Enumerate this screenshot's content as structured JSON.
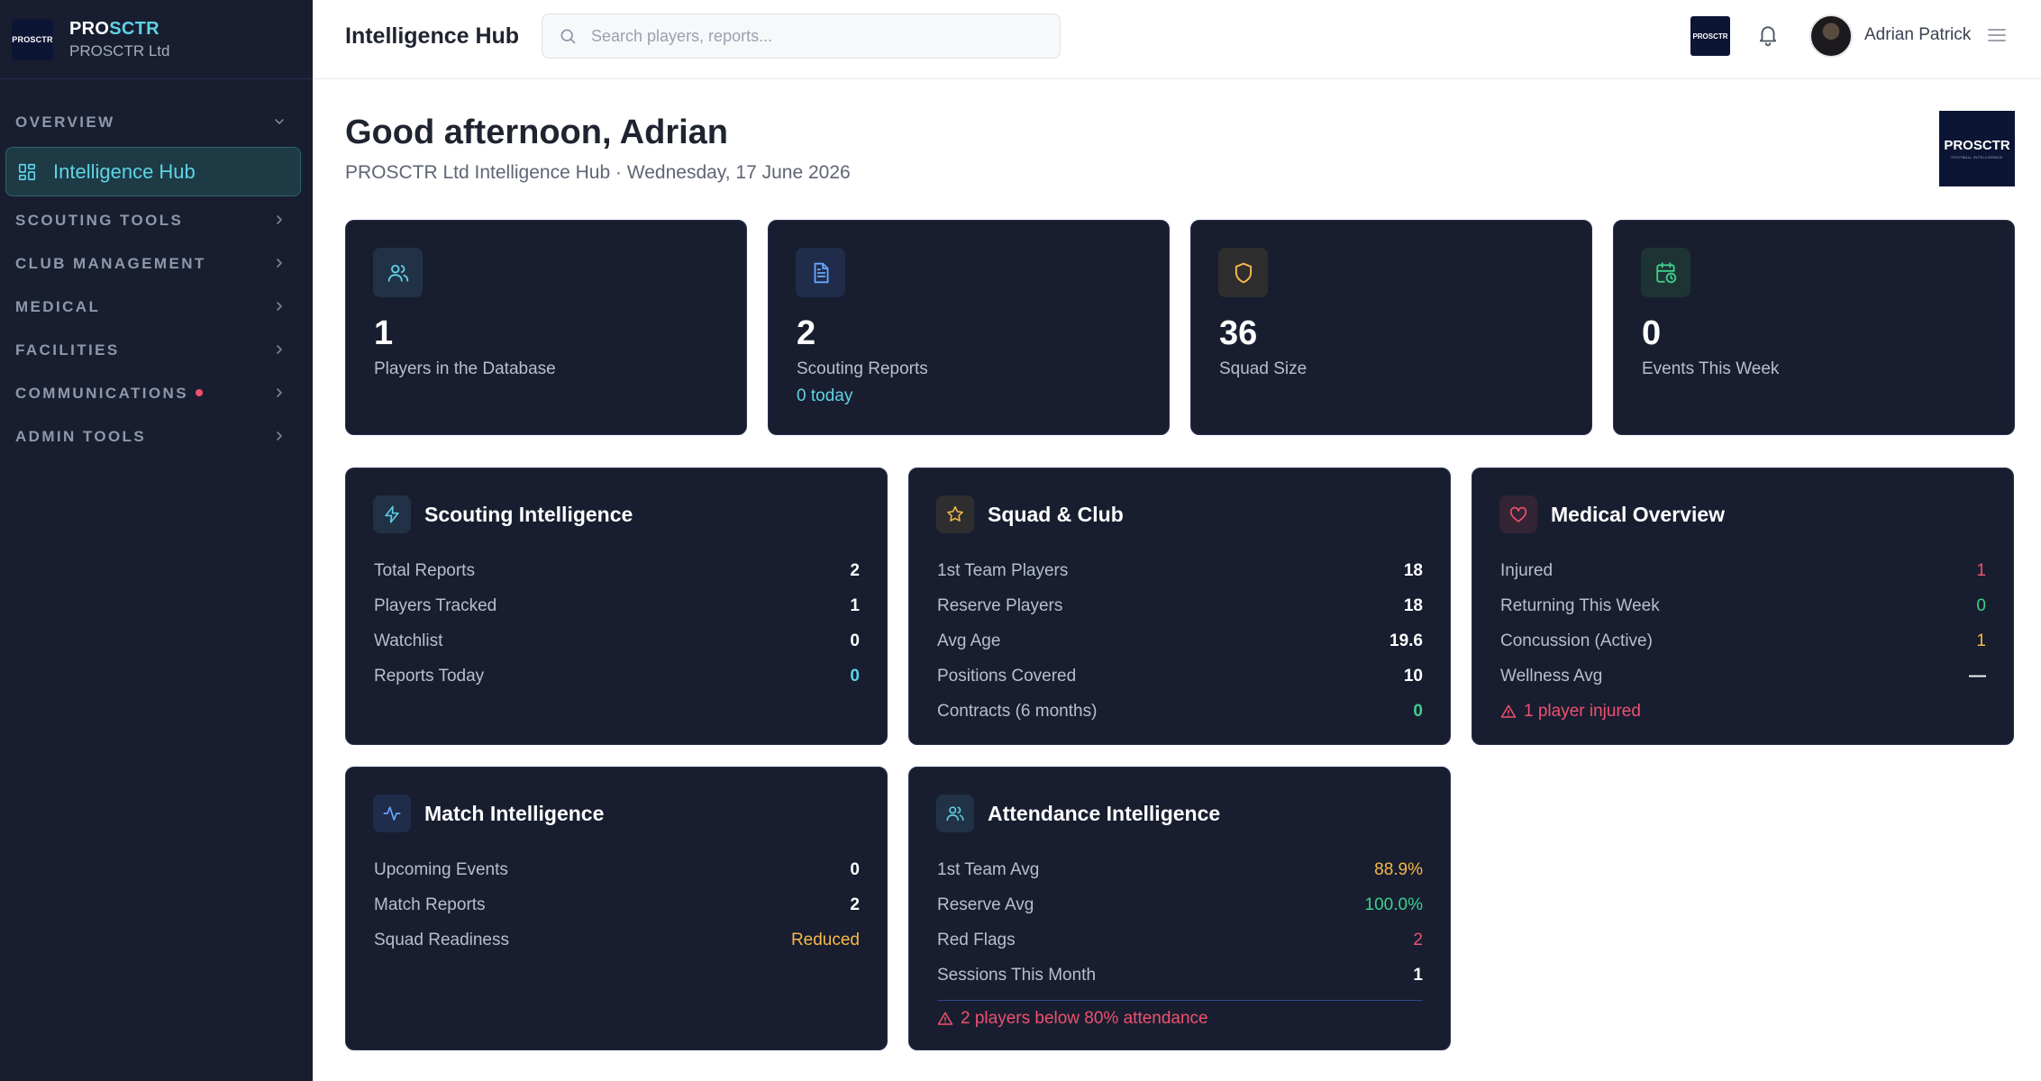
{
  "sidebar": {
    "brand": {
      "logo_text": "PROSCTR",
      "name_pro": "PRO",
      "name_sctr": "SCTR",
      "org": "PROSCTR Ltd"
    },
    "sections": {
      "overview": "OVERVIEW",
      "scouting_tools": "SCOUTING TOOLS",
      "club_management": "CLUB MANAGEMENT",
      "medical": "MEDICAL",
      "facilities": "FACILITIES",
      "communications": "COMMUNICATIONS",
      "admin_tools": "ADMIN TOOLS"
    },
    "active_item": "Intelligence Hub",
    "communications_has_notification": true
  },
  "header": {
    "title": "Intelligence Hub",
    "search_placeholder": "Search players, reports...",
    "logo_text": "PROSCTR",
    "user_name": "Adrian Patrick"
  },
  "main": {
    "greeting": "Good afternoon, Adrian",
    "subtitle": "PROSCTR Ltd Intelligence Hub · Wednesday, 17 June 2026",
    "logo_text": "PROSCTR",
    "logo_tagline": "FOOTBALL INTELLIGENCE"
  },
  "stats": [
    {
      "icon": "users-icon",
      "value": "1",
      "label": "Players in the Database",
      "sub": ""
    },
    {
      "icon": "document-icon",
      "value": "2",
      "label": "Scouting Reports",
      "sub": "0 today"
    },
    {
      "icon": "shield-icon",
      "value": "36",
      "label": "Squad Size",
      "sub": ""
    },
    {
      "icon": "calendar-clock-icon",
      "value": "0",
      "label": "Events This Week",
      "sub": ""
    }
  ],
  "panels": {
    "scouting": {
      "title": "Scouting Intelligence",
      "rows": [
        {
          "label": "Total Reports",
          "value": "2"
        },
        {
          "label": "Players Tracked",
          "value": "1"
        },
        {
          "label": "Watchlist",
          "value": "0"
        },
        {
          "label": "Reports Today",
          "value": "0"
        }
      ]
    },
    "squad": {
      "title": "Squad & Club",
      "rows": [
        {
          "label": "1st Team Players",
          "value": "18"
        },
        {
          "label": "Reserve Players",
          "value": "18"
        },
        {
          "label": "Avg Age",
          "value": "19.6"
        },
        {
          "label": "Positions Covered",
          "value": "10"
        },
        {
          "label": "Contracts (6 months)",
          "value": "0"
        }
      ]
    },
    "medical": {
      "title": "Medical Overview",
      "rows": [
        {
          "label": "Injured",
          "value": "1"
        },
        {
          "label": "Returning This Week",
          "value": "0"
        },
        {
          "label": "Concussion (Active)",
          "value": "1"
        },
        {
          "label": "Wellness Avg",
          "value": "—"
        }
      ],
      "alert": "1 player injured"
    },
    "match": {
      "title": "Match Intelligence",
      "rows": [
        {
          "label": "Upcoming Events",
          "value": "0"
        },
        {
          "label": "Match Reports",
          "value": "2"
        },
        {
          "label": "Squad Readiness",
          "value": "Reduced"
        }
      ]
    },
    "attendance": {
      "title": "Attendance Intelligence",
      "rows": [
        {
          "label": "1st Team Avg",
          "value": "88.9%"
        },
        {
          "label": "Reserve Avg",
          "value": "100.0%"
        },
        {
          "label": "Red Flags",
          "value": "2"
        },
        {
          "label": "Sessions This Month",
          "value": "1"
        }
      ],
      "alert": "2 players below 80% attendance"
    }
  },
  "colors": {
    "accent": "#5fd3e6",
    "sidebar_bg": "#181e30",
    "card_bg": "#181e30",
    "danger": "#f0506e",
    "warning": "#f5b84a",
    "success": "#3ecf8e"
  }
}
